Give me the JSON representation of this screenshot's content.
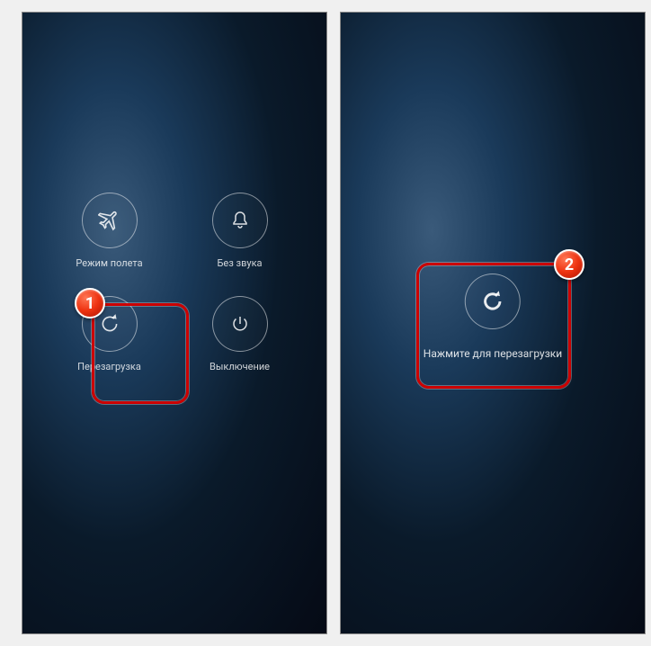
{
  "annotations": {
    "step1": "1",
    "step2": "2"
  },
  "screen1": {
    "airplane_label": "Режим полета",
    "silent_label": "Без звука",
    "reboot_label": "Перезагрузка",
    "poweroff_label": "Выключение"
  },
  "screen2": {
    "confirm_label": "Нажмите для перезагрузки"
  }
}
